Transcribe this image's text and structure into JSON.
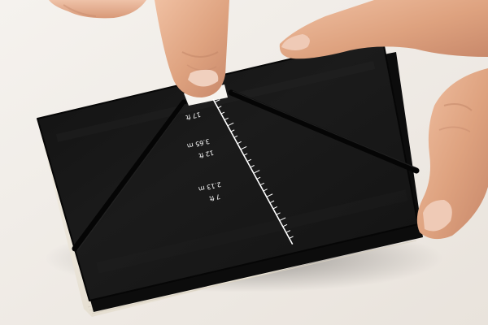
{
  "photo": {
    "background_color": "#f0ece7",
    "notebook_color": "#171717",
    "page_edge_color": "#f4efe2",
    "elastic_color": "#080808",
    "skin_color": "#e2ac8c"
  },
  "ruler": {
    "labels": [
      {
        "text": "17 ft"
      },
      {
        "text": "12 ft"
      },
      {
        "text": "3.65 m"
      },
      {
        "text": "7 ft"
      },
      {
        "text": "2.13 m"
      }
    ]
  }
}
